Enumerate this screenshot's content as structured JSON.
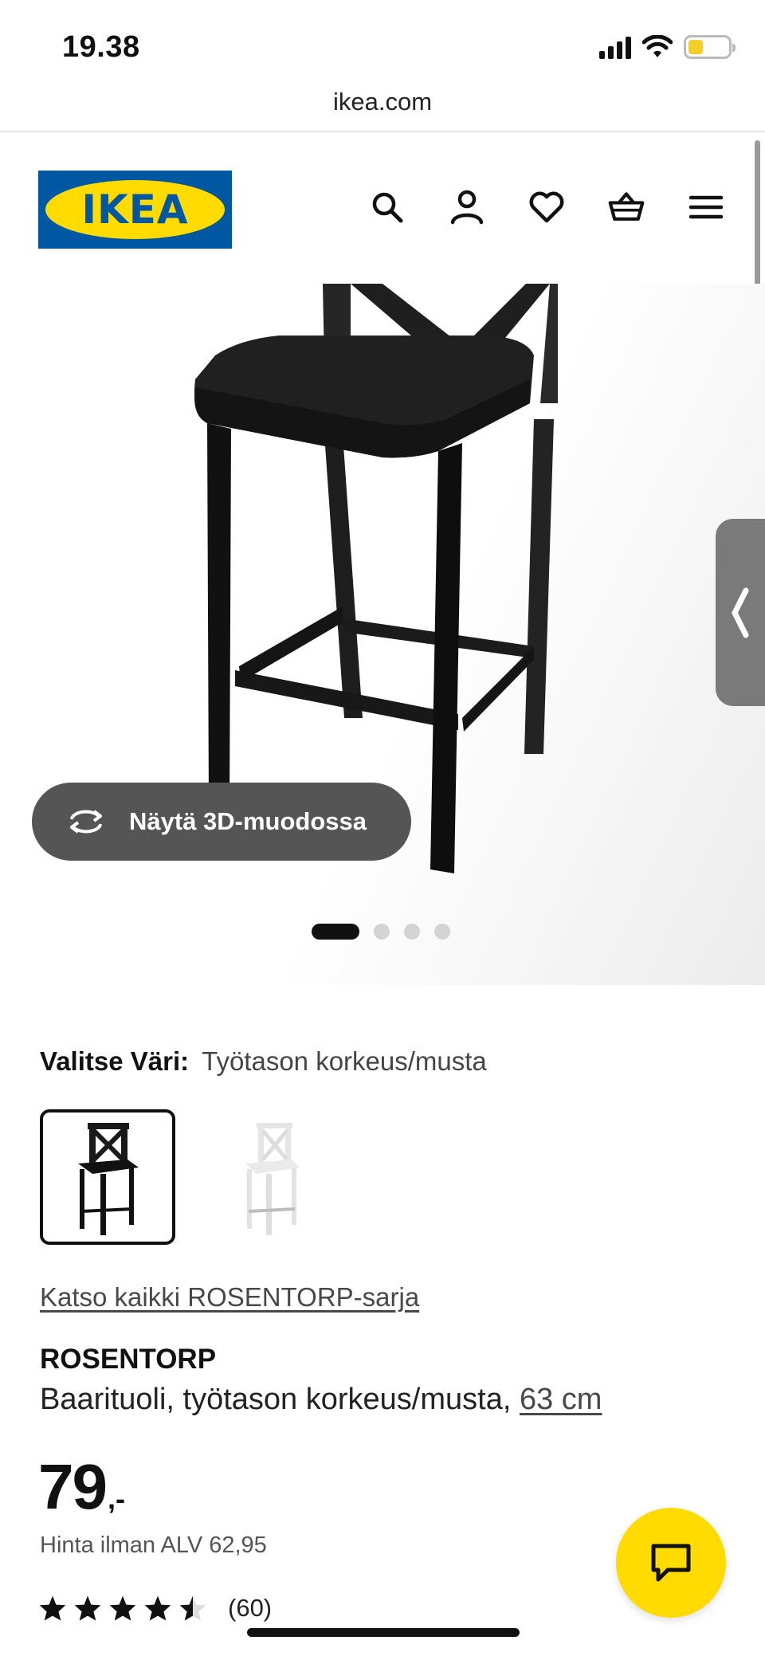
{
  "status_bar": {
    "time": "19.38"
  },
  "browser": {
    "url": "ikea.com"
  },
  "header": {
    "logo_text": "IKEA",
    "brand_colors": {
      "blue": "#0058a3",
      "yellow": "#ffdb00"
    },
    "icons": [
      "search-icon",
      "account-icon",
      "heart-icon",
      "basket-icon",
      "menu-icon"
    ]
  },
  "gallery": {
    "view_3d_label": "Näytä 3D-muodossa",
    "image_count": 4,
    "active_index": 0
  },
  "color_select": {
    "label": "Valitse Väri:",
    "value": "Työtason korkeus/musta",
    "options": [
      "black",
      "white"
    ],
    "selected_index": 0
  },
  "series_link": "Katso kaikki ROSENTORP-sarja",
  "product": {
    "name": "ROSENTORP",
    "description": "Baarituoli, työtason korkeus/musta,",
    "size": "63 cm",
    "price": "79",
    "price_suffix": ",-",
    "vat_text": "Hinta ilman ALV 62,95",
    "rating": 4.5,
    "rating_count": "(60)"
  }
}
